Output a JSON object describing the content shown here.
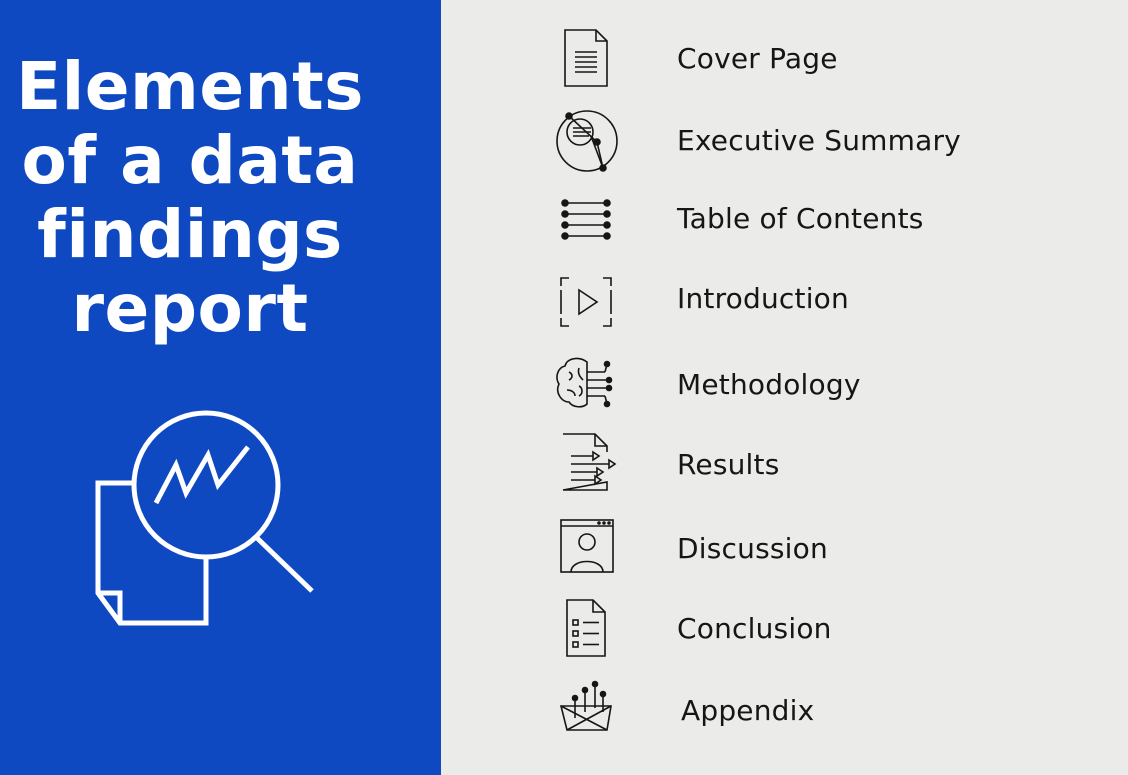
{
  "title": {
    "line1": "Elements",
    "line2": "of a data",
    "line3": "findings",
    "line4": "report"
  },
  "hero_icon": "magnifier-over-document-chart-icon",
  "colors": {
    "left_panel": "#0f49c2",
    "right_panel": "#ebebe9",
    "title_text": "#ffffff",
    "item_text": "#161616"
  },
  "items": [
    {
      "label": "Cover Page",
      "icon": "document-icon"
    },
    {
      "label": "Executive Summary",
      "icon": "summary-network-icon"
    },
    {
      "label": "Table of Contents",
      "icon": "list-icon"
    },
    {
      "label": "Introduction",
      "icon": "play-frame-icon"
    },
    {
      "label": "Methodology",
      "icon": "brain-circuit-icon"
    },
    {
      "label": "Results",
      "icon": "document-arrows-icon"
    },
    {
      "label": "Discussion",
      "icon": "user-window-icon"
    },
    {
      "label": "Conclusion",
      "icon": "checklist-document-icon"
    },
    {
      "label": "Appendix",
      "icon": "data-basket-icon"
    }
  ]
}
